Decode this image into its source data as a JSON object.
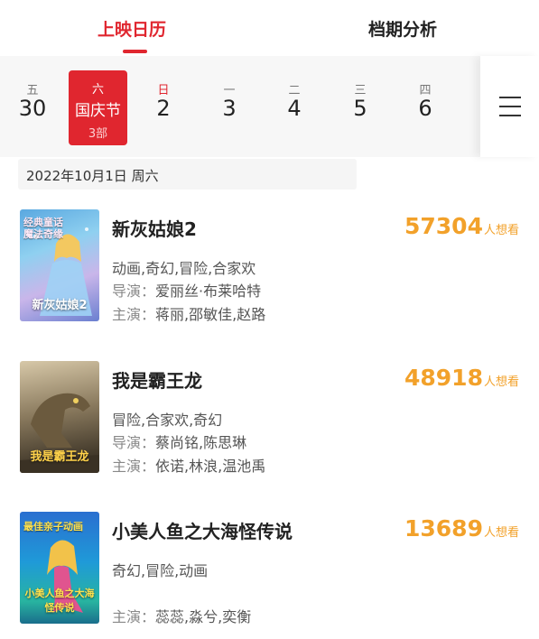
{
  "tabs": {
    "calendar": "上映日历",
    "analysis": "档期分析"
  },
  "days": [
    {
      "weekday": "五",
      "date": "30"
    },
    {
      "weekday": "六",
      "date": "国庆节",
      "count": "3部",
      "selected": true
    },
    {
      "weekday": "日",
      "date": "2"
    },
    {
      "weekday": "一",
      "date": "3"
    },
    {
      "weekday": "二",
      "date": "4"
    },
    {
      "weekday": "三",
      "date": "5"
    },
    {
      "weekday": "四",
      "date": "6"
    }
  ],
  "date_header": "2022年10月1日  周六",
  "want_label": "人想看",
  "movies": [
    {
      "title": "新灰姑娘2",
      "want": "57304",
      "genres": "动画,奇幻,冒险,合家欢",
      "director_label": "导演：",
      "director": "爱丽丝·布莱哈特",
      "cast_label": "主演：",
      "cast": "蒋丽,邵敏佳,赵路",
      "poster_title": "新灰姑娘2",
      "poster_tag": "经典童话 魔法奇缘"
    },
    {
      "title": "我是霸王龙",
      "want": "48918",
      "genres": "冒险,合家欢,奇幻",
      "director_label": "导演：",
      "director": "蔡尚铭,陈思琳",
      "cast_label": "主演：",
      "cast": "依诺,林浪,温池禹",
      "poster_title": "我是霸王龙",
      "poster_tag": ""
    },
    {
      "title": "小美人鱼之大海怪传说",
      "want": "13689",
      "genres": "奇幻,冒险,动画",
      "cast_label": "主演：",
      "cast": "蕊蕊,淼兮,奕衡",
      "poster_title": "小美人鱼之大海怪传说",
      "poster_tag": "最佳亲子动画"
    }
  ]
}
